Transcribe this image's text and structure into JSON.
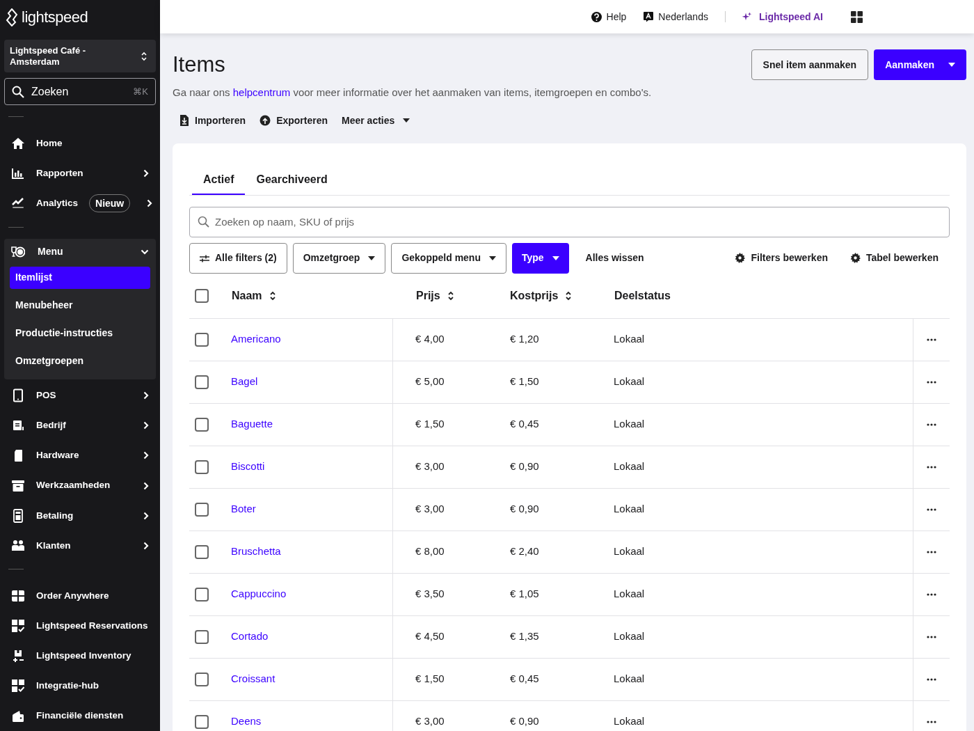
{
  "sidebar": {
    "logo": "lightspeed",
    "location": "Lightspeed Café - Amsterdam",
    "search": {
      "placeholder": "Zoeken",
      "shortcut": "⌘K"
    },
    "sections": [
      [
        {
          "label": "Home",
          "has_submenu": false
        },
        {
          "label": "Rapporten",
          "has_submenu": true
        },
        {
          "label": "Analytics",
          "badge": "Nieuw",
          "has_submenu": true
        }
      ],
      [
        {
          "label": "Menu",
          "expanded": true,
          "children": [
            {
              "label": "Itemlijst",
              "selected": true
            },
            {
              "label": "Menubeheer",
              "selected": false
            },
            {
              "label": "Productie-instructies",
              "selected": false
            },
            {
              "label": "Omzetgroepen",
              "selected": false
            }
          ]
        },
        {
          "label": "POS",
          "has_submenu": true
        },
        {
          "label": "Bedrijf",
          "has_submenu": true
        },
        {
          "label": "Hardware",
          "has_submenu": true
        },
        {
          "label": "Werkzaamheden",
          "has_submenu": true
        },
        {
          "label": "Betaling",
          "has_submenu": true
        },
        {
          "label": "Klanten",
          "has_submenu": true
        }
      ],
      [
        {
          "label": "Order Anywhere",
          "has_submenu": false
        },
        {
          "label": "Lightspeed Reservations",
          "has_submenu": false
        },
        {
          "label": "Lightspeed Inventory",
          "has_submenu": false
        },
        {
          "label": "Integratie-hub",
          "has_submenu": false
        },
        {
          "label": "Financiële diensten",
          "has_submenu": false
        }
      ]
    ]
  },
  "topbar": {
    "help": "Help",
    "language": "Nederlands",
    "ai": "Lightspeed AI"
  },
  "page": {
    "title": "Items",
    "description": {
      "before": "Ga naar ons",
      "link": "helpcentrum",
      "after": "voor meer informatie over het aanmaken van items, itemgroepen en combo's."
    },
    "actions": [
      {
        "label": "Importeren",
        "kind": "import"
      },
      {
        "label": "Exporteren",
        "kind": "export"
      },
      {
        "label": "Meer acties",
        "kind": "dropdown"
      }
    ],
    "buttons": [
      {
        "label": "Snel item aanmaken",
        "kind": "secondary"
      },
      {
        "label": "Aanmaken",
        "kind": "primary"
      }
    ]
  },
  "tabs": [
    {
      "label": "Actief",
      "selected": true
    },
    {
      "label": "Gearchiveerd",
      "selected": false
    }
  ],
  "search": {
    "placeholder": "Zoeken op naam, SKU of prijs"
  },
  "filters": [
    {
      "label": "Alle filters (2)",
      "kind": "filters",
      "selected": false
    },
    {
      "label": "Omzetgroep",
      "kind": "dropdown",
      "selected": false
    },
    {
      "label": "Gekoppeld menu",
      "kind": "dropdown",
      "selected": false
    },
    {
      "label": "Type",
      "kind": "dropdown",
      "selected": true
    }
  ],
  "clear_all": "Alles wissen",
  "table_tools": [
    "Filters bewerken",
    "Tabel bewerken"
  ],
  "table": {
    "select_all_checked": false,
    "columns": [
      {
        "label": "Naam",
        "sortable": true
      },
      {
        "label": "Prijs",
        "sortable": true
      },
      {
        "label": "Kostprijs",
        "sortable": true
      },
      {
        "label": "Deelstatus",
        "sortable": false
      }
    ],
    "rows": [
      {
        "name": "Americano",
        "price": "€ 4,00",
        "cost": "€ 1,20",
        "status": "Lokaal",
        "checked": false
      },
      {
        "name": "Bagel",
        "price": "€ 5,00",
        "cost": "€ 1,50",
        "status": "Lokaal",
        "checked": false
      },
      {
        "name": "Baguette",
        "price": "€ 1,50",
        "cost": "€ 0,45",
        "status": "Lokaal",
        "checked": false
      },
      {
        "name": "Biscotti",
        "price": "€ 3,00",
        "cost": "€ 0,90",
        "status": "Lokaal",
        "checked": false
      },
      {
        "name": "Boter",
        "price": "€ 3,00",
        "cost": "€ 0,90",
        "status": "Lokaal",
        "checked": false
      },
      {
        "name": "Bruschetta",
        "price": "€ 8,00",
        "cost": "€ 2,40",
        "status": "Lokaal",
        "checked": false
      },
      {
        "name": "Cappuccino",
        "price": "€ 3,50",
        "cost": "€ 1,05",
        "status": "Lokaal",
        "checked": false
      },
      {
        "name": "Cortado",
        "price": "€ 4,50",
        "cost": "€ 1,35",
        "status": "Lokaal",
        "checked": false
      },
      {
        "name": "Croissant",
        "price": "€ 1,50",
        "cost": "€ 0,45",
        "status": "Lokaal",
        "checked": false
      },
      {
        "name": "Deens",
        "price": "€ 3,00",
        "cost": "€ 0,90",
        "status": "Lokaal",
        "checked": false
      }
    ]
  }
}
